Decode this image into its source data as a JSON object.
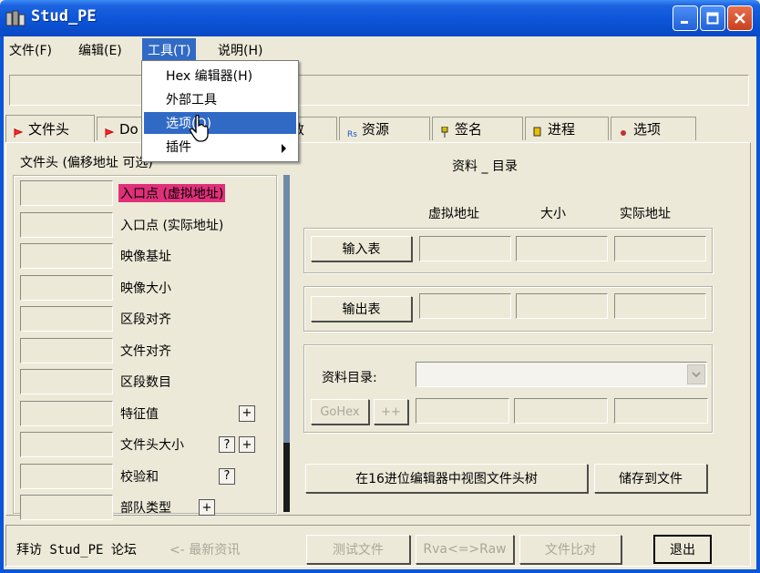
{
  "window": {
    "title": "Stud_PE"
  },
  "menubar": [
    {
      "label": "文件(F)"
    },
    {
      "label": "编辑(E)"
    },
    {
      "label": "工具(T)"
    },
    {
      "label": "说明(H)"
    }
  ],
  "tools_menu": {
    "items": [
      {
        "label": "Hex 编辑器(H)"
      },
      {
        "label": "外部工具"
      },
      {
        "label": "选项(O)"
      },
      {
        "label": "插件"
      }
    ]
  },
  "tabs": [
    {
      "label": "文件头"
    },
    {
      "label": "Do"
    },
    {
      "label": "数"
    },
    {
      "label": "资源"
    },
    {
      "label": "签名"
    },
    {
      "label": "进程"
    },
    {
      "label": "选项"
    }
  ],
  "left_panel": {
    "title": "文件头 (偏移地址 可选)",
    "rows": [
      {
        "label": "入口点 (虚拟地址)"
      },
      {
        "label": "入口点 (实际地址)"
      },
      {
        "label": "映像基址"
      },
      {
        "label": "映像大小"
      },
      {
        "label": "区段对齐"
      },
      {
        "label": "文件对齐"
      },
      {
        "label": "区段数目"
      },
      {
        "label": "特征值"
      },
      {
        "label": "文件头大小"
      },
      {
        "label": "校验和"
      },
      {
        "label": "部队类型"
      }
    ],
    "plus": "+",
    "question": "?"
  },
  "right_panel": {
    "title": "资料 _ 目录",
    "col_headers": [
      "虚拟地址",
      "大小",
      "实际地址"
    ],
    "import_button": "输入表",
    "export_button": "输出表",
    "dir_label": "资料目录:",
    "gohex_button": "GoHex",
    "plusplus_button": "++",
    "view_tree_button": "在16进位编辑器中视图文件头树",
    "save_button": "储存到文件"
  },
  "bottom": {
    "visit_forum": "拜访 Stud_PE 论坛",
    "news": "<- 最新资讯",
    "test_file": "测试文件",
    "rva_raw": "Rva<=>Raw",
    "compare": "文件比对",
    "exit": "退出"
  },
  "colors": {
    "accent": "#316ac5",
    "highlight": "#e0307a",
    "titlebar": "#0b55d8"
  }
}
